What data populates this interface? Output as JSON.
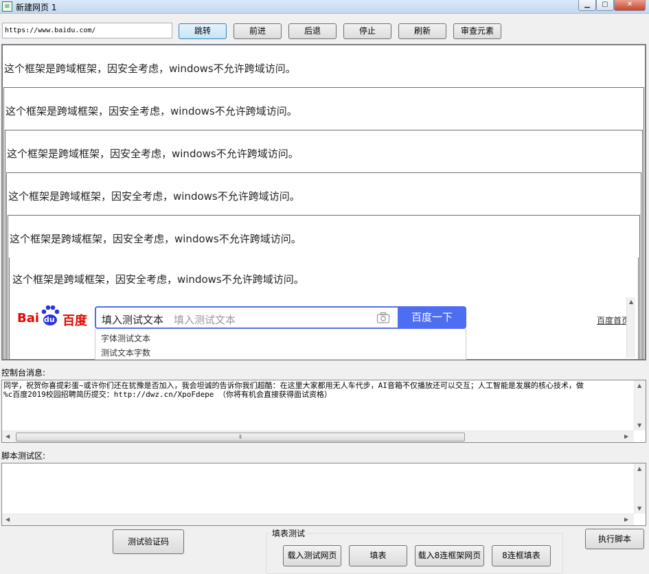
{
  "window": {
    "title": "新建网页 1",
    "app_icon": "page-icon",
    "min_glyph": "▁",
    "max_glyph": "▢",
    "close_glyph": "✕"
  },
  "toolbar": {
    "url_value": "https://www.baidu.com/",
    "go_label": "跳转",
    "forward_label": "前进",
    "back_label": "后退",
    "stop_label": "停止",
    "refresh_label": "刷新",
    "inspect_label": "审查元素"
  },
  "browser": {
    "frame_messages": [
      "这个框架是跨域框架，因安全考虑，windows不允许跨域访问。",
      "这个框架是跨域框架，因安全考虑，windows不允许跨域访问。",
      "这个框架是跨域框架，因安全考虑，windows不允许跨域访问。",
      "这个框架是跨域框架，因安全考虑，windows不允许跨域访问。",
      "这个框架是跨域框架，因安全考虑，windows不允许跨域访问。",
      "这个框架是跨域框架，因安全考虑，windows不允许跨域访问。"
    ],
    "baidu": {
      "logo_bai": "Bai",
      "logo_du": "du",
      "logo_cn": "百度",
      "search_value": "填入测试文本",
      "search_placeholder": "填入测试文本",
      "search_button": "百度一下",
      "home_link": "百度首页",
      "suggestions": [
        "字体测试文本",
        "测试文本字数"
      ],
      "brand_color": "#4e6ef2",
      "logo_color": "#e10601"
    }
  },
  "console": {
    "label": "控制台消息:",
    "lines": [
      "同学，祝贺你喜提彩蛋~或许你们还在犹豫是否加入，我会坦诚的告诉你我们超酷：在这里大家都用无人车代步，AI音箱不仅播放还可以交互；人工智能是发展的核心技术，做",
      "%c百度2019校园招聘简历提交：http://dwz.cn/XpoFdepe （你将有机会直接获得面试资格）"
    ],
    "scroll_thumb_glyph": "⦀"
  },
  "script": {
    "label": "脚本测试区:"
  },
  "bottom": {
    "captcha_label": "测试验证码",
    "group_title": "填表测试",
    "load_test_label": "载入测试网页",
    "fill_label": "填表",
    "load8_label": "载入8连框架网页",
    "fill8_label": "8连框填表",
    "run_label": "执行脚本"
  }
}
